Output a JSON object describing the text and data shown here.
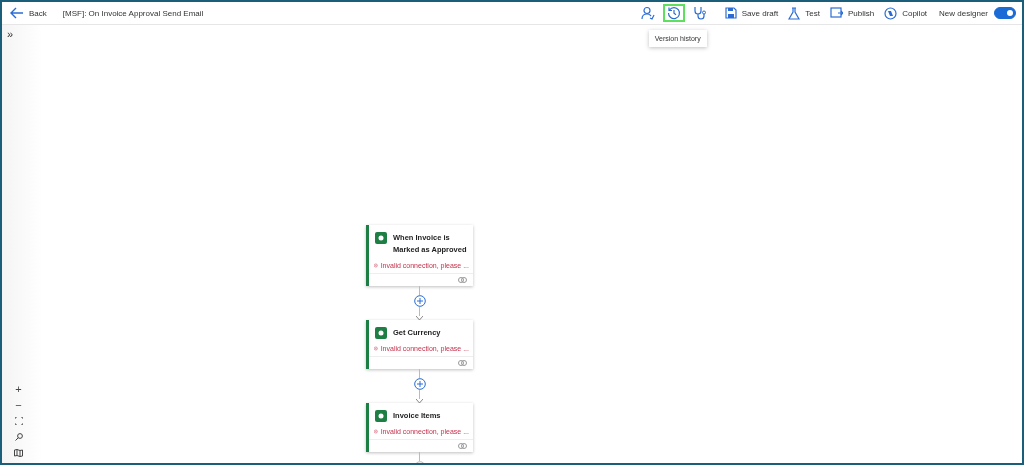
{
  "header": {
    "back": "Back",
    "title": "[MSF]: On Invoice Approval Send Email"
  },
  "icon_buttons": [
    {
      "kind": "person",
      "highlighted": false
    },
    {
      "kind": "history",
      "highlighted": true,
      "tooltip": "Version history"
    },
    {
      "kind": "stethoscope",
      "highlighted": false
    }
  ],
  "actions": [
    {
      "kind": "save",
      "label": "Save draft"
    },
    {
      "kind": "flask",
      "label": "Test"
    },
    {
      "kind": "publish",
      "label": "Publish"
    },
    {
      "kind": "copilot",
      "label": "Copilot"
    }
  ],
  "designer_toggle": {
    "label": "New designer",
    "on": true
  },
  "sidebar_toggle": "»",
  "nodes": [
    {
      "title": "When Invoice is Marked as Approved",
      "error": "Invalid connection, please ..."
    },
    {
      "title": "Get Currency",
      "error": "Invalid connection, please ..."
    },
    {
      "title": "Invoice Items",
      "error": "Invalid connection, please ..."
    }
  ],
  "zoom_controls": [
    "+",
    "−"
  ]
}
